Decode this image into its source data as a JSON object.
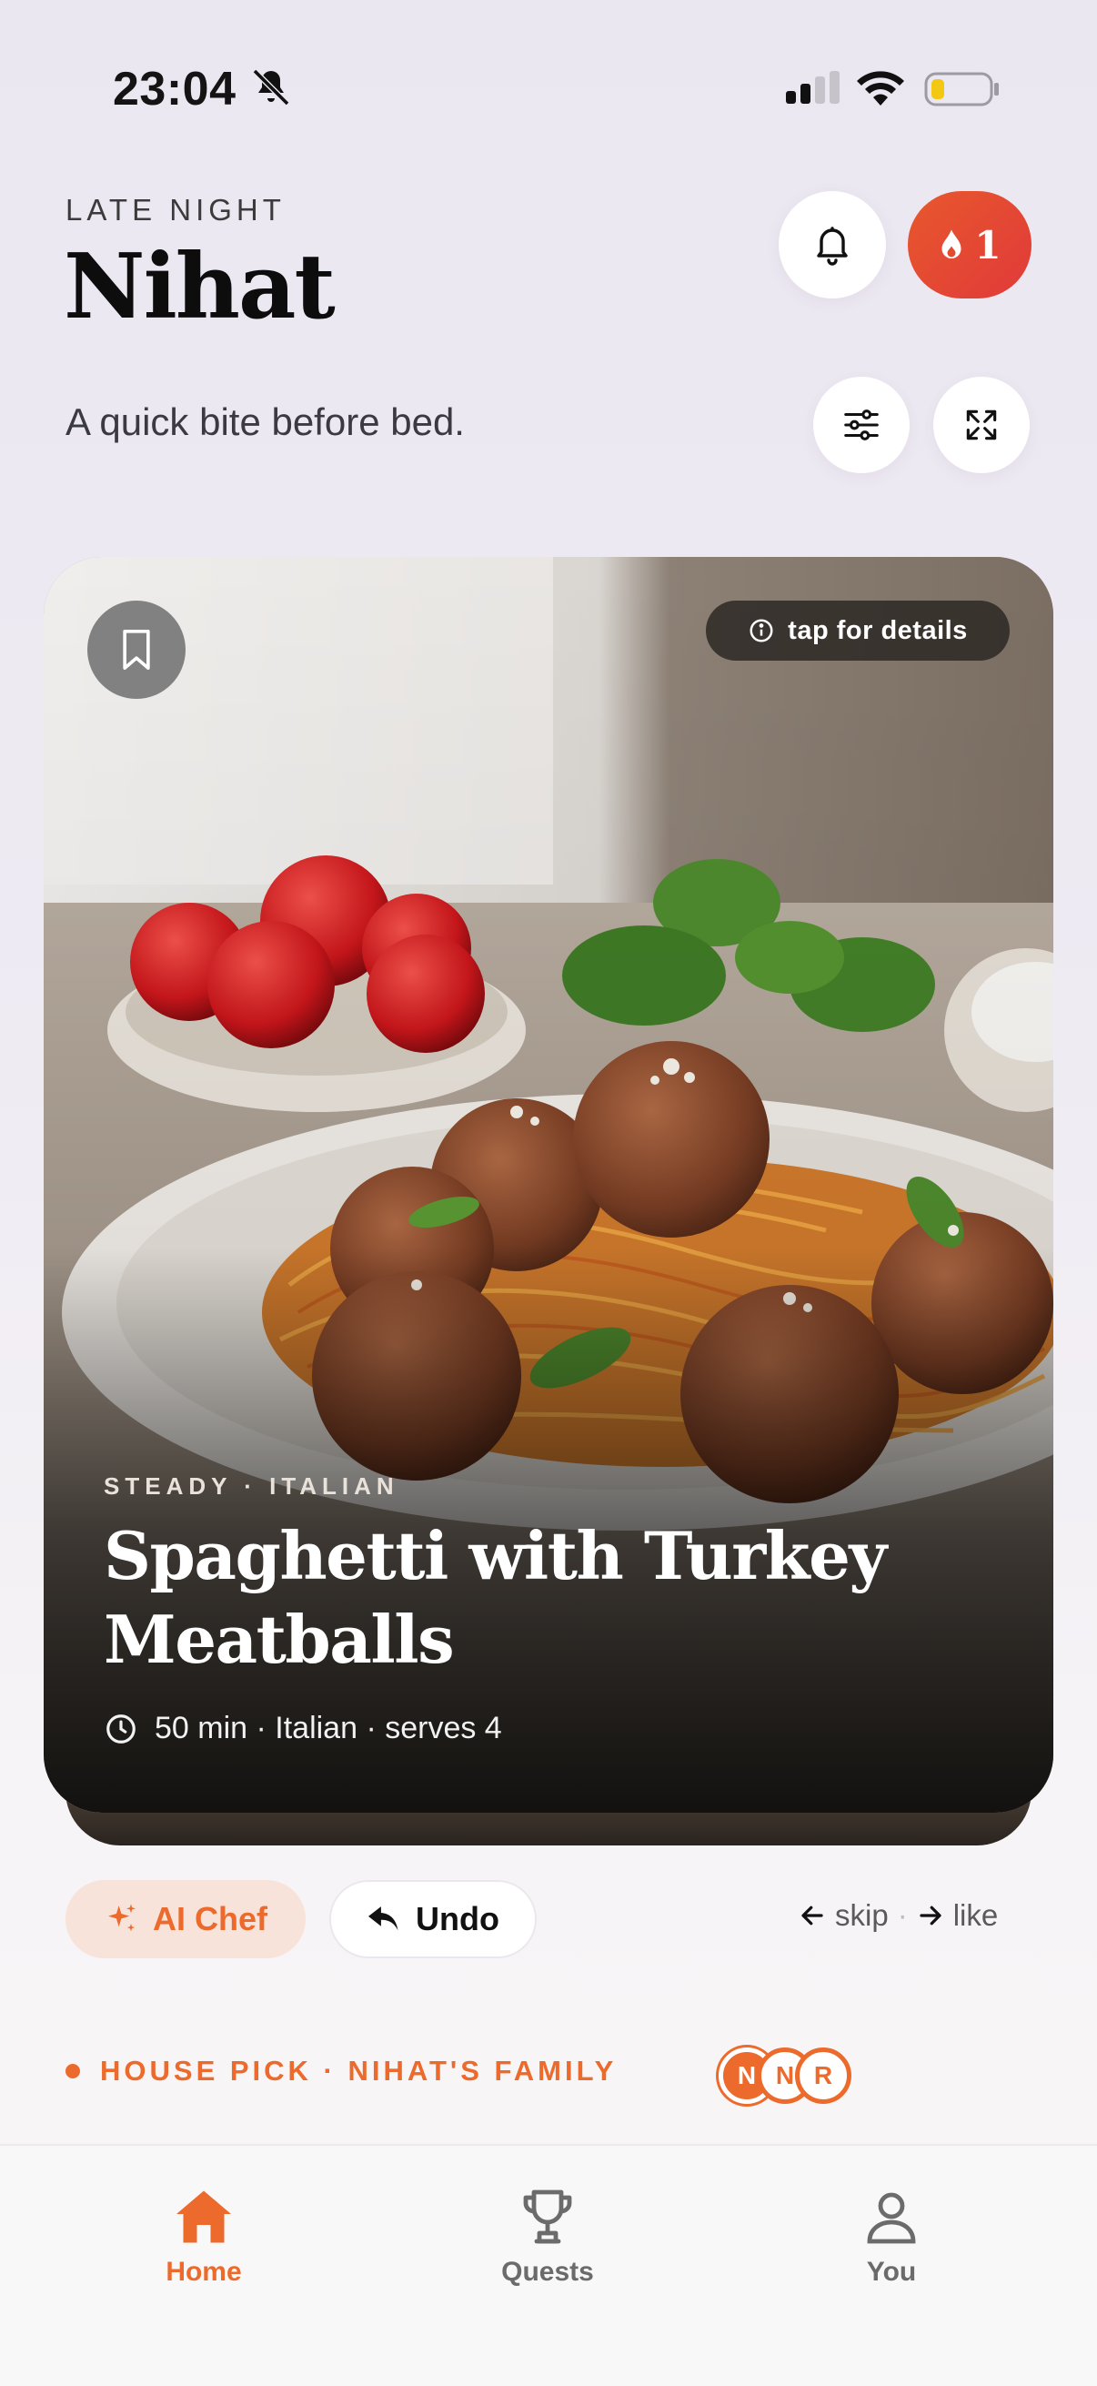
{
  "status_bar": {
    "time": "23:04"
  },
  "header": {
    "eyebrow": "LATE NIGHT",
    "name": "Nihat",
    "tagline": "A quick bite before bed.",
    "streak_count": "1"
  },
  "card": {
    "details_label": "tap for details",
    "kicker": "STEADY · ITALIAN",
    "title": "Spaghetti with Turkey Meatballs",
    "meta": "50 min · Italian · serves 4"
  },
  "actions": {
    "ai_chef_label": "AI Chef",
    "undo_label": "Undo",
    "skip_label": "skip",
    "like_label": "like"
  },
  "house_pick": {
    "label": "HOUSE PICK · NIHAT'S FAMILY",
    "avatars": [
      "N",
      "N",
      "R"
    ]
  },
  "nav": {
    "items": [
      {
        "label": "Home",
        "icon": "home-icon",
        "active": true
      },
      {
        "label": "Quests",
        "icon": "trophy-icon",
        "active": false
      },
      {
        "label": "You",
        "icon": "person-icon",
        "active": false
      }
    ]
  },
  "colors": {
    "accent": "#ec6a2c",
    "streak": "#e44a30"
  }
}
